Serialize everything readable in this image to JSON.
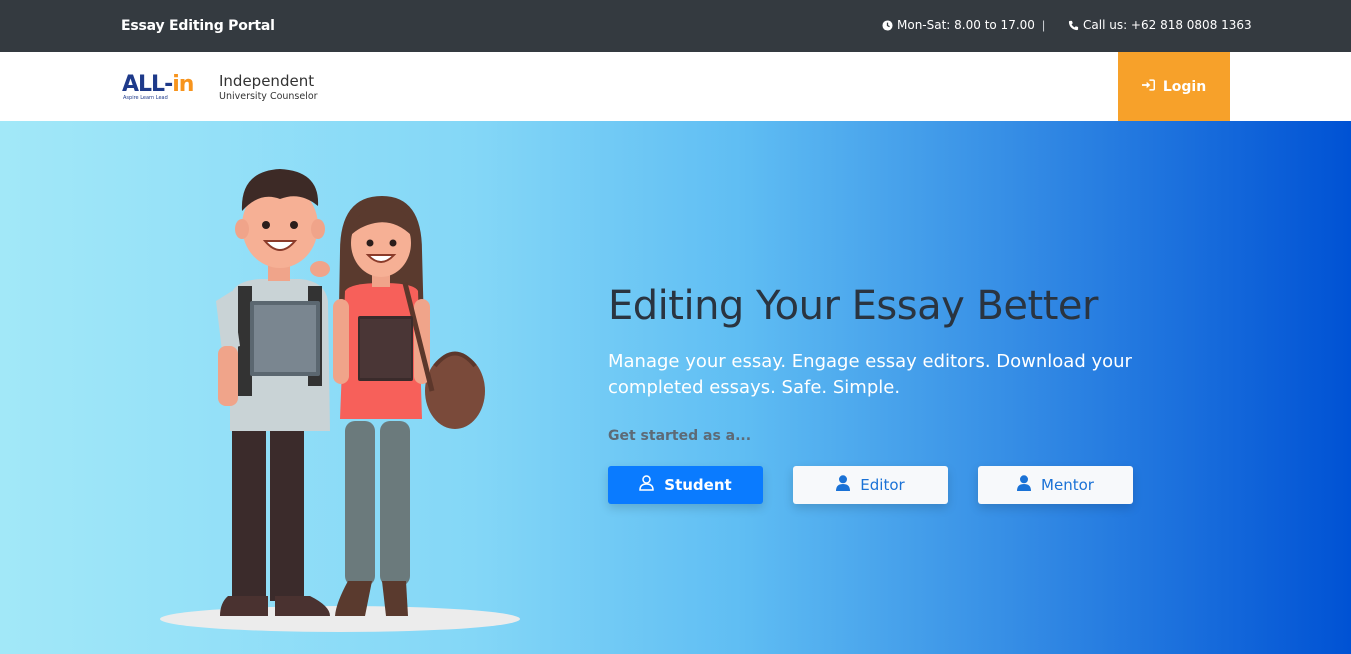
{
  "topbar": {
    "brand": "Essay Editing Portal",
    "hours": "Mon-Sat: 8.00 to 17.00",
    "separator": "|",
    "phone": "Call us: +62 818 0808 1363"
  },
  "navbar": {
    "logo": {
      "wordmark_main": "ALL-",
      "wordmark_accent": "in",
      "tagline": "Aspire  Learn  Lead",
      "line1": "Independent",
      "line2": "University Counselor"
    },
    "login_label": "Login"
  },
  "hero": {
    "headline": "Editing Your Essay Better",
    "subtext": "Manage your essay. Engage essay editors. Download your completed essays. Safe. Simple.",
    "get_started": "Get started as a...",
    "roles": [
      {
        "label": "Student",
        "icon": "user-outline-icon"
      },
      {
        "label": "Editor",
        "icon": "user-solid-icon"
      },
      {
        "label": "Mentor",
        "icon": "user-solid-icon"
      }
    ]
  },
  "colors": {
    "topbar_bg": "#343a40",
    "login_bg": "#f7a12a",
    "primary": "#0a7bff",
    "hero_gradient_start": "#a2e8f8",
    "hero_gradient_end": "#0052d4"
  }
}
